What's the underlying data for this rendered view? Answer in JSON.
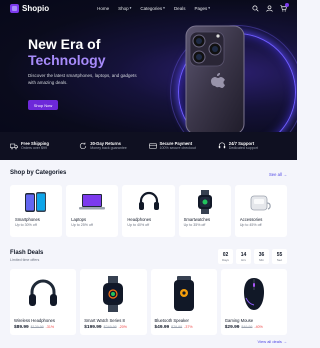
{
  "nav": {
    "brand": "Shopio",
    "links": [
      {
        "label": "Home",
        "dropdown": false
      },
      {
        "label": "Shop",
        "dropdown": true
      },
      {
        "label": "Categories",
        "dropdown": true
      },
      {
        "label": "Deals",
        "dropdown": false
      },
      {
        "label": "Pages",
        "dropdown": true
      }
    ],
    "icons": [
      "search-icon",
      "user-icon",
      "cart-icon"
    ]
  },
  "hero": {
    "title_line1": "New Era of",
    "title_line2": "Technology",
    "subtitle": "Discover the latest smartphones, laptops, and gadgets with amazing deals.",
    "cta": "Shop Now"
  },
  "features": [
    {
      "icon": "truck-icon",
      "title": "Free Shipping",
      "subtitle": "Orders over $99"
    },
    {
      "icon": "return-icon",
      "title": "30-Day Returns",
      "subtitle": "Money back guarantee"
    },
    {
      "icon": "card-icon",
      "title": "Secure Payment",
      "subtitle": "100% secure checkout"
    },
    {
      "icon": "headset-icon",
      "title": "24/7 Support",
      "subtitle": "Dedicated support"
    }
  ],
  "categories": {
    "title": "Shop by Categories",
    "see_all": "See all",
    "items": [
      {
        "name": "Smartphones",
        "offer": "Up to 30% off",
        "icon": "smartphone-icon"
      },
      {
        "name": "Laptops",
        "offer": "Up to 25% off",
        "icon": "laptop-icon"
      },
      {
        "name": "Headphones",
        "offer": "Up to 40% off",
        "icon": "headphones-icon"
      },
      {
        "name": "Smartwatches",
        "offer": "Up to 35% off",
        "icon": "smartwatch-icon"
      },
      {
        "name": "Accessories",
        "offer": "Up to 45% off",
        "icon": "accessories-icon"
      }
    ]
  },
  "flash": {
    "title": "Flash Deals",
    "subtitle": "Limited time offers",
    "timer": [
      {
        "value": "02",
        "label": "Days"
      },
      {
        "value": "14",
        "label": "Hrs"
      },
      {
        "value": "36",
        "label": "Min"
      },
      {
        "value": "55",
        "label": "Sec"
      }
    ],
    "deals": [
      {
        "name": "Wireless Headphones",
        "price": "$89.99",
        "old": "$129.99",
        "discount": "-31%",
        "icon": "headphones-icon"
      },
      {
        "name": "Smart Watch Series 8",
        "price": "$199.99",
        "old": "$249.99",
        "discount": "-20%",
        "icon": "smartwatch-icon"
      },
      {
        "name": "Bluetooth Speaker",
        "price": "$49.99",
        "old": "$79.99",
        "discount": "-37%",
        "icon": "speaker-icon"
      },
      {
        "name": "Gaming Mouse",
        "price": "$29.99",
        "old": "$49.99",
        "discount": "-40%",
        "icon": "mouse-icon"
      }
    ],
    "view_all": "View all deals →"
  },
  "colors": {
    "accent": "#6d28d9",
    "accent_light": "#a78bfa",
    "hero_bg": "#0a0b1c",
    "discount": "#ef4444"
  }
}
